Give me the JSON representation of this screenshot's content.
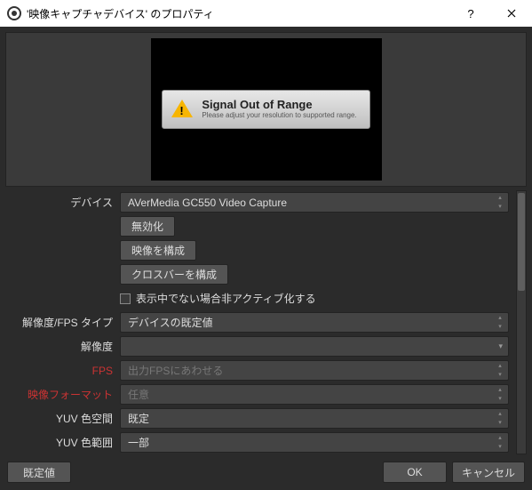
{
  "titlebar": {
    "title": "'映像キャプチャデバイス' のプロパティ"
  },
  "preview": {
    "heading": "Signal Out of Range",
    "sub": "Please adjust your resolution to supported range."
  },
  "form": {
    "device_label": "デバイス",
    "device_value": "AVerMedia GC550 Video Capture",
    "btn_disable": "無効化",
    "btn_config_video": "映像を構成",
    "btn_config_crossbar": "クロスバーを構成",
    "chk_deactivate": "表示中でない場合非アクティブ化する",
    "res_type_label": "解像度/FPS タイプ",
    "res_type_value": "デバイスの既定値",
    "res_label": "解像度",
    "res_value": "",
    "fps_label": "FPS",
    "fps_value": "出力FPSにあわせる",
    "vfmt_label": "映像フォーマット",
    "vfmt_value": "任意",
    "yuv_space_label": "YUV 色空間",
    "yuv_space_value": "既定",
    "yuv_range_label": "YUV 色範囲",
    "yuv_range_value": "一部"
  },
  "footer": {
    "defaults": "既定値",
    "ok": "OK",
    "cancel": "キャンセル"
  }
}
